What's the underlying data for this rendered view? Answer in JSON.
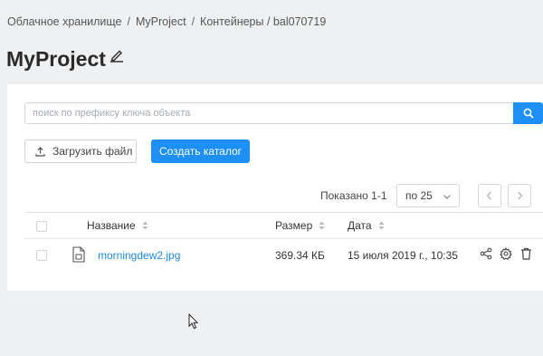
{
  "breadcrumb": {
    "items": [
      "Облачное хранилище",
      "MyProject",
      "Контейнеры / bal070719"
    ],
    "separator": "/"
  },
  "page": {
    "title": "MyProject"
  },
  "search": {
    "placeholder": "поиск по префиксу ключа объекта",
    "value": ""
  },
  "actions": {
    "upload_label": "Загрузить файл",
    "create_folder_label": "Создать каталог"
  },
  "pagination": {
    "shown_text": "Показано 1-1",
    "per_page": "по 25"
  },
  "table": {
    "columns": {
      "name": "Название",
      "size": "Размер",
      "date": "Дата"
    },
    "rows": [
      {
        "name": "morningdew2.jpg",
        "size": "369.34 КБ",
        "date": "15 июля 2019 г., 10:35"
      }
    ]
  },
  "icons": {
    "edit": "pencil-icon",
    "search": "search-icon",
    "upload": "upload-icon",
    "dropdown": "chevron-down-icon",
    "prev": "chevron-left-icon",
    "next": "chevron-right-icon",
    "file": "image-file-icon",
    "share": "share-icon",
    "settings": "gear-icon",
    "delete": "trash-icon"
  },
  "colors": {
    "accent": "#1e90f5",
    "link": "#1e88e5",
    "background": "#eef0f2"
  }
}
